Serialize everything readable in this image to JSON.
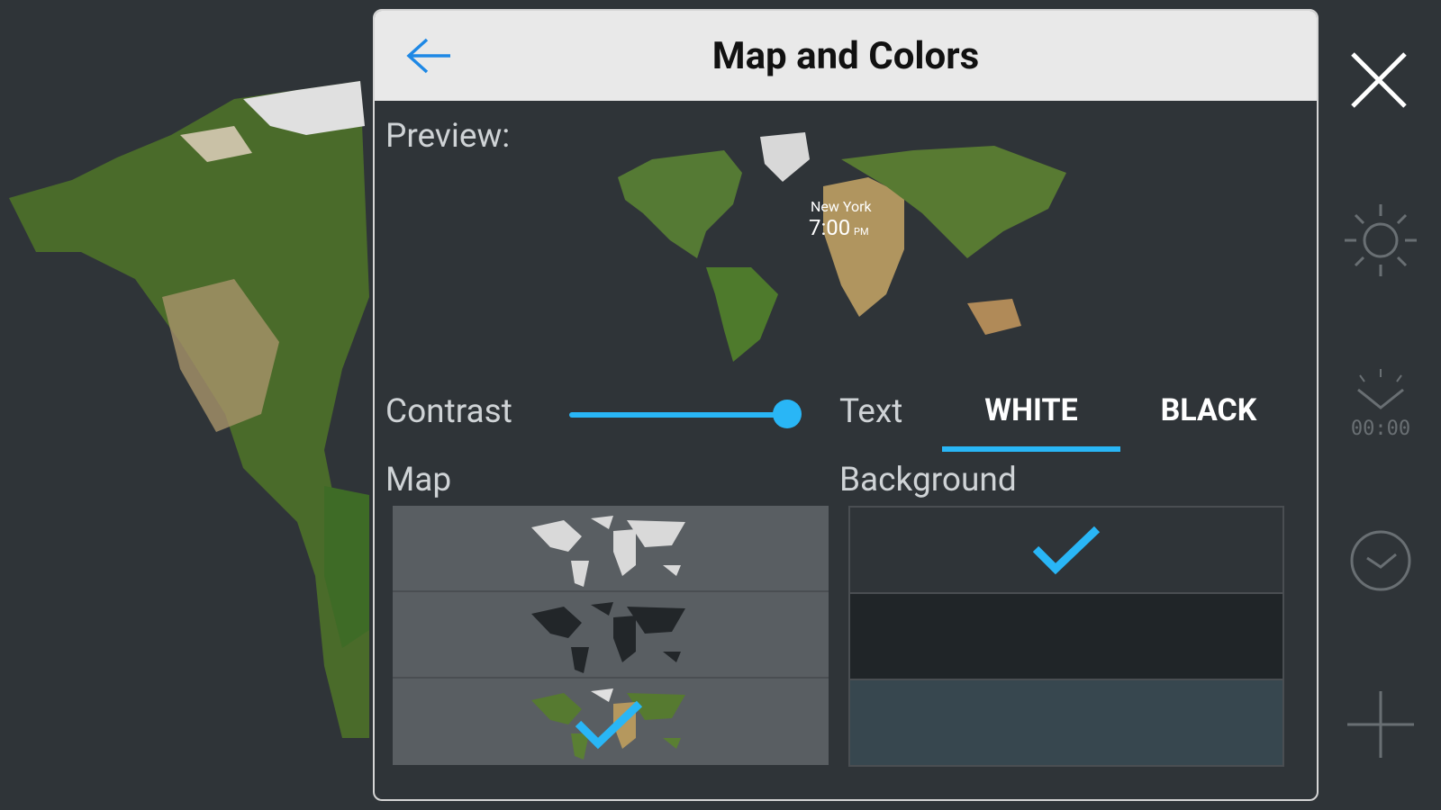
{
  "dialog": {
    "title": "Map and Colors",
    "preview_label": "Preview:",
    "preview_city": "New York",
    "preview_time": "7:00",
    "preview_ampm": "PM",
    "contrast_label": "Contrast",
    "contrast_value": 1.0,
    "text_label": "Text",
    "text_options": [
      "WHITE",
      "BLACK"
    ],
    "text_selected": "WHITE",
    "map_label": "Map",
    "map_options": [
      "light",
      "dark",
      "satellite"
    ],
    "map_selected": "satellite",
    "background_label": "Background",
    "background_options": [
      "#2f3438",
      "#202528",
      "#37474f"
    ],
    "background_selected": "#2f3438"
  },
  "colors": {
    "accent": "#29b6f6",
    "back_arrow": "#1e88e5"
  },
  "toolbar": {
    "icons": [
      "close-icon",
      "brightness-icon",
      "alarm-clock-icon",
      "sync-icon",
      "add-icon"
    ]
  }
}
